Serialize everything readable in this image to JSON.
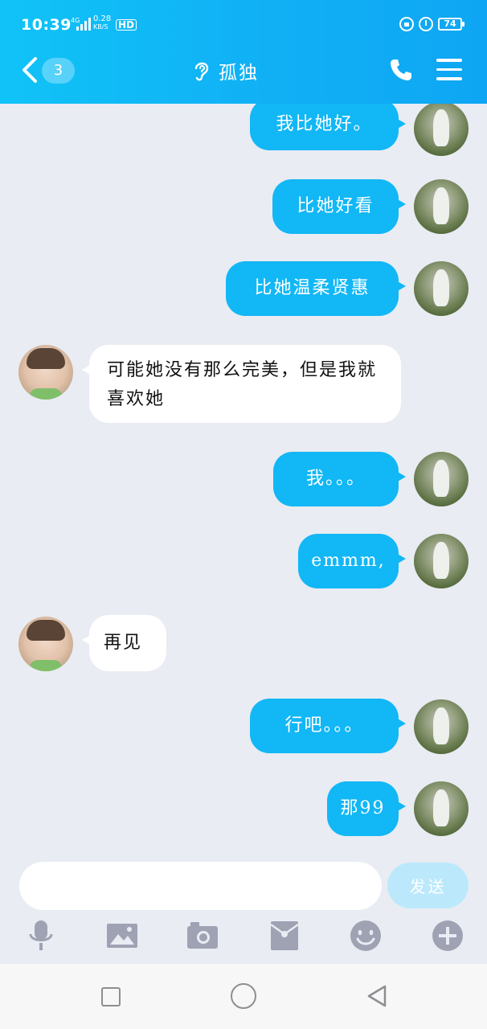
{
  "status_bar": {
    "time": "10:39",
    "network": "4G",
    "speed_value": "0.28",
    "speed_unit": "KB/S",
    "hd": "HD",
    "battery": "74"
  },
  "header": {
    "unread_count": "3",
    "title": "孤独",
    "icons": [
      "back-icon",
      "ear-icon",
      "phone-icon",
      "menu-icon"
    ]
  },
  "messages": [
    {
      "sender": "me",
      "text": "我比她好。"
    },
    {
      "sender": "me",
      "text": "比她好看"
    },
    {
      "sender": "me",
      "text": "比她温柔贤惠"
    },
    {
      "sender": "other",
      "text": "可能她没有那么完美，但是我就喜欢她"
    },
    {
      "sender": "me",
      "text": "我。。。"
    },
    {
      "sender": "me",
      "text": "emmm,"
    },
    {
      "sender": "other",
      "text": "再见"
    },
    {
      "sender": "me",
      "text": "行吧。。。"
    },
    {
      "sender": "me",
      "text": "那99"
    }
  ],
  "composer": {
    "input_value": "",
    "send_label": "发送",
    "tools": [
      "microphone-icon",
      "image-icon",
      "camera-icon",
      "red-packet-icon",
      "emoji-icon",
      "plus-icon"
    ]
  },
  "colors": {
    "header": "#12b7f5",
    "my_bubble": "#12b7f5",
    "other_bubble": "#ffffff",
    "background": "#e9ecf3",
    "send_disabled": "#bbe9fb",
    "toolbar_icon": "#9fa2b3"
  }
}
